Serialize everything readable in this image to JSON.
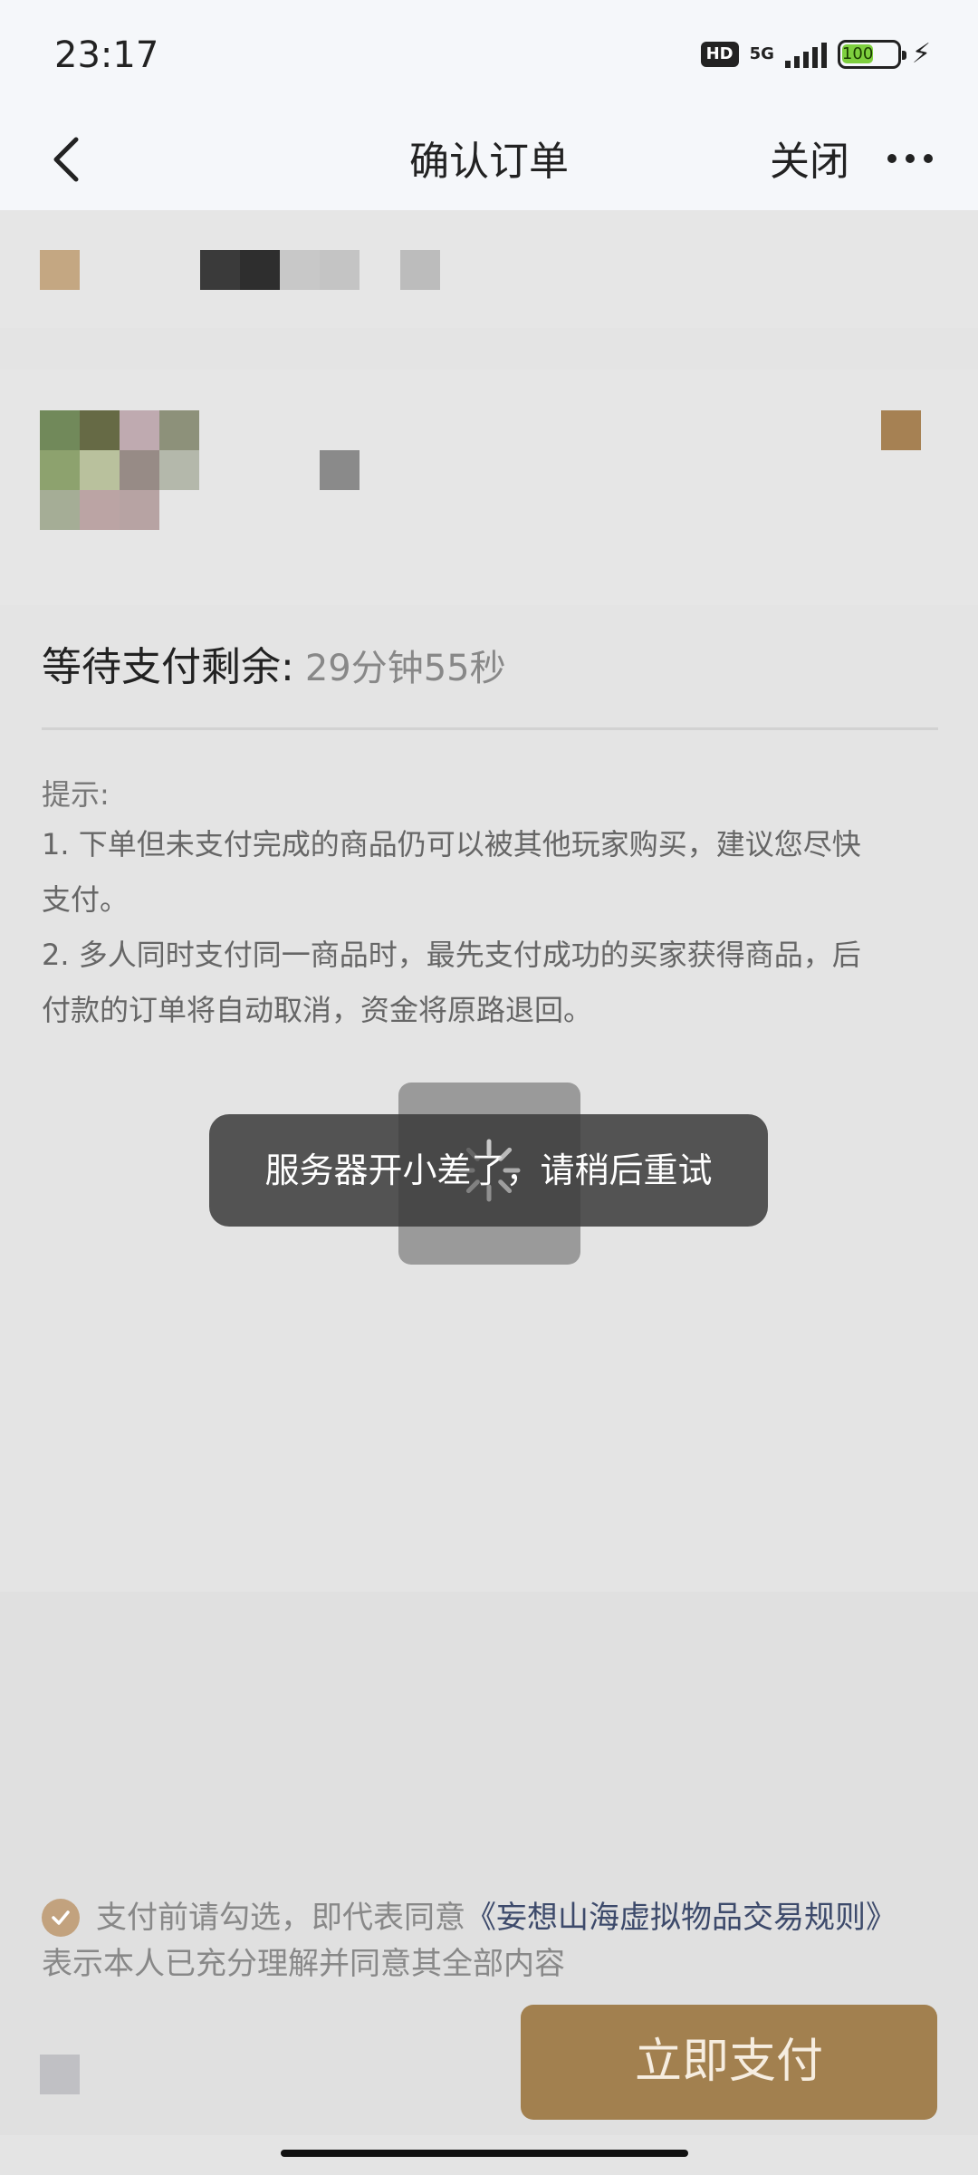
{
  "status_bar": {
    "time": "23:17",
    "hd": "HD",
    "network": "5G",
    "battery": "100",
    "signal_bars": 5,
    "charging": true
  },
  "nav": {
    "title": "确认订单",
    "close_label": "关闭",
    "back_icon": "chevron-left-icon",
    "more_icon": "ellipsis-icon"
  },
  "order": {
    "timer_label": "等待支付剩余:",
    "timer_value": "29分钟55秒"
  },
  "tips": {
    "title": "提示:",
    "lines": [
      "1. 下单但未支付完成的商品仍可以被其他玩家购买，建议您尽快",
      "支付。",
      "2. 多人同时支付同一商品时，最先支付成功的买家获得商品，后",
      "付款的订单将自动取消，资金将原路退回。"
    ]
  },
  "toast": {
    "message": "服务器开小差了，请稍后重试"
  },
  "agreement": {
    "checked": true,
    "prefix": "支付前请勾选，即代表同意",
    "link": "《妄想山海虚拟物品交易规则》",
    "line2": "表示本人已充分理解并同意其全部内容"
  },
  "pay_button": {
    "label": "立即支付"
  },
  "colors": {
    "accent": "#a2804f",
    "check": "#c2a27e",
    "link": "#3d4a6b",
    "battery": "#7ecf3e"
  }
}
